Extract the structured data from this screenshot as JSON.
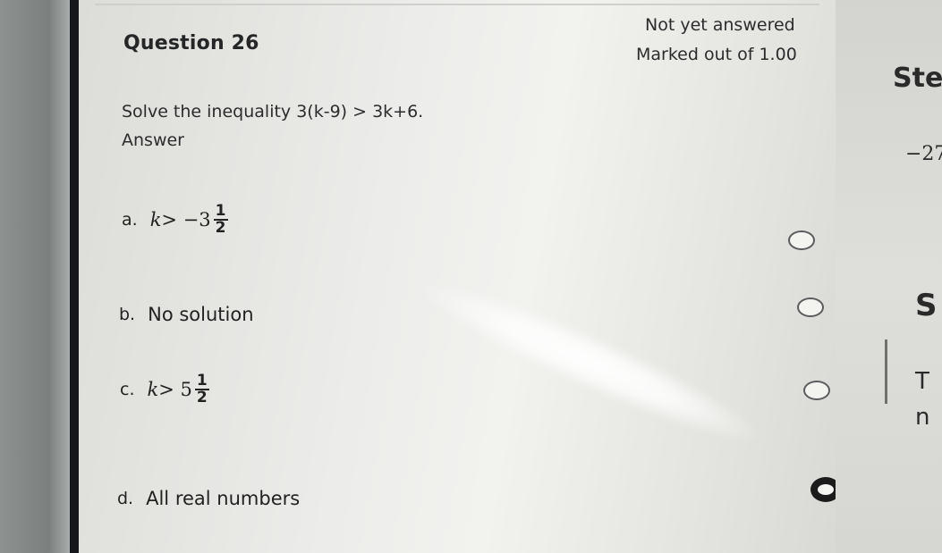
{
  "question": {
    "title": "Question 26",
    "status": "Not yet answered",
    "marks": "Marked out of 1.00",
    "prompt": "Solve the inequality 3(k-9) > 3k+6.",
    "answer_label": "Answer"
  },
  "options": [
    {
      "letter": "a.",
      "math_var": "k",
      "math_rel": " > −3",
      "frac_num": "1",
      "frac_den": "2",
      "selected": false
    },
    {
      "letter": "b.",
      "text": "No solution",
      "selected": false
    },
    {
      "letter": "c.",
      "math_var": "k",
      "math_rel": " > 5",
      "frac_num": "1",
      "frac_den": "2",
      "selected": false
    },
    {
      "letter": "d.",
      "text": "All real numbers",
      "selected": true
    }
  ],
  "side_panel": {
    "heading_fragment": "Ste",
    "value_fragment": "−27",
    "fragment_s": "S",
    "fragment_t": "T",
    "fragment_n": "n"
  },
  "colors": {
    "radio_border": "#5a5b5d",
    "radio_checked": "#1b1b1c",
    "text": "#2b2c2d"
  }
}
